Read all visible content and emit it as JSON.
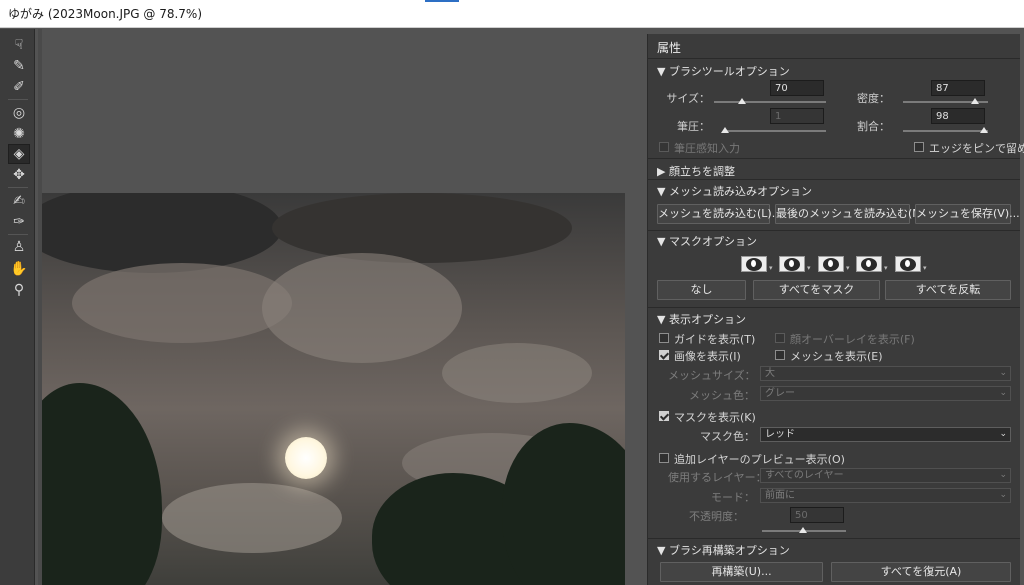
{
  "window": {
    "title": "ゆがみ (2023Moon.JPG @ 78.7%)"
  },
  "tools": [
    {
      "name": "forward-warp-tool",
      "glyph": "☟"
    },
    {
      "name": "reconstruct-tool",
      "glyph": "✎"
    },
    {
      "name": "smooth-tool",
      "glyph": "✐"
    },
    {
      "name": "twirl-tool",
      "glyph": "◎"
    },
    {
      "name": "pucker-tool",
      "glyph": "✺"
    },
    {
      "name": "bloat-tool",
      "glyph": "◈"
    },
    {
      "name": "push-left-tool",
      "glyph": "✥"
    },
    {
      "name": "freeze-mask-tool",
      "glyph": "✍"
    },
    {
      "name": "thaw-mask-tool",
      "glyph": "✑"
    },
    {
      "name": "face-tool",
      "glyph": "♙"
    },
    {
      "name": "hand-tool",
      "glyph": "✋"
    },
    {
      "name": "zoom-tool",
      "glyph": "⚲"
    }
  ],
  "panel": {
    "title": "属性",
    "brush_tool_options": {
      "header": "▼ ブラシツールオプション",
      "size_label": "サイズ：",
      "size_value": "70",
      "density_label": "密度：",
      "density_value": "87",
      "pressure_label": "筆圧：",
      "pressure_value": "1",
      "rate_label": "割合：",
      "rate_value": "98",
      "stylus_label": "筆圧感知入力",
      "pin_edges_label": "エッジをピンで留める"
    },
    "face_aware": {
      "header": "▶ 顔立ちを調整"
    },
    "load_mesh": {
      "header": "▼ メッシュ読み込みオプション",
      "load_btn": "メッシュを読み込む(L)...",
      "load_last_btn": "最後のメッシュを読み込む(M)",
      "save_btn": "メッシュを保存(V)..."
    },
    "mask_options": {
      "header": "▼ マスクオプション",
      "none_btn": "なし",
      "mask_all_btn": "すべてをマスク",
      "invert_all_btn": "すべてを反転"
    },
    "view_options": {
      "header": "▼ 表示オプション",
      "show_guides": "ガイドを表示(T)",
      "show_face_overlay": "顔オーバーレイを表示(F)",
      "show_image": "画像を表示(I)",
      "show_mesh": "メッシュを表示(E)",
      "mesh_size_label": "メッシュサイズ：",
      "mesh_size_value": "大",
      "mesh_color_label": "メッシュ色：",
      "mesh_color_value": "グレー",
      "show_mask": "マスクを表示(K)",
      "mask_color_label": "マスク色：",
      "mask_color_value": "レッド",
      "show_backdrop": "追加レイヤーのプレビュー表示(O)",
      "use_layer_label": "使用するレイヤー：",
      "use_layer_value": "すべてのレイヤー",
      "mode_label": "モード：",
      "mode_value": "前面に",
      "opacity_label": "不透明度：",
      "opacity_value": "50"
    },
    "brush_reconstruct": {
      "header": "▼ ブラシ再構築オプション",
      "reconstruct_btn": "再構築(U)...",
      "restore_all_btn": "すべてを復元(A)"
    }
  },
  "colors": {
    "accent": "#2d6fc4",
    "panel_bg": "#3b3b3b",
    "workspace_bg": "#535353"
  }
}
